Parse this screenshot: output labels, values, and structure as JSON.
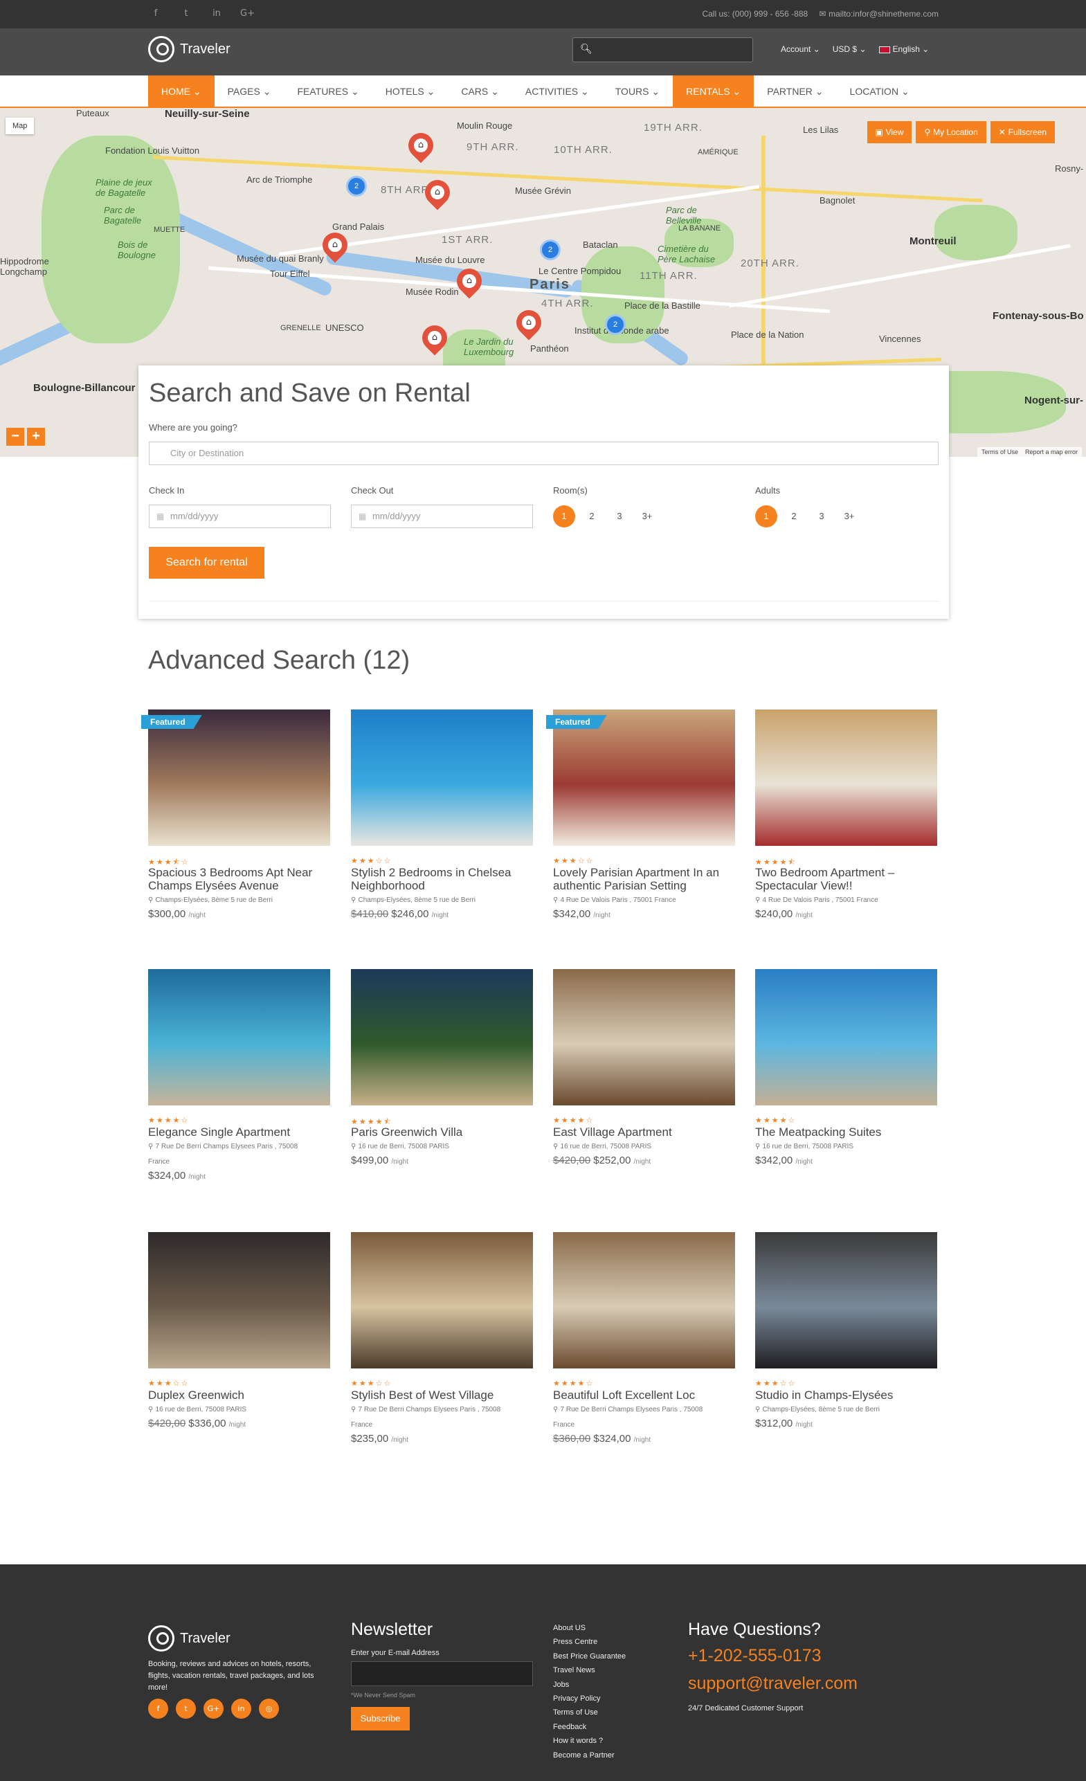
{
  "topbar": {
    "social": [
      "f",
      "t",
      "in",
      "G+"
    ],
    "phone": "Call us: (000) 999 - 656 -888",
    "email": "mailto:infor@shinetheme.com"
  },
  "header": {
    "logo": "Traveler",
    "search_icon": "search-icon",
    "account": "Account",
    "currency": "USD $",
    "language": "English"
  },
  "nav": [
    "HOME",
    "PAGES",
    "FEATURES",
    "HOTELS",
    "CARS",
    "ACTIVITIES",
    "TOURS",
    "RENTALS",
    "PARTNER",
    "LOCATION"
  ],
  "map": {
    "type_button": "Map",
    "view": "View",
    "my_location": "My Location",
    "fullscreen": "Fullscreen",
    "terms": "Terms of Use",
    "report": "Report a map error",
    "labels": {
      "neuilly": "Neuilly-sur-Seine",
      "puteaux": "Puteaux",
      "fondation": "Fondation Louis Vuitton",
      "plaine": "Plaine de jeux de Bagatelle",
      "parc": "Parc de Bagatelle",
      "bois": "Bois de Boulogne",
      "hippodrome": "Hippodrome Longchamp",
      "muette": "MUETTE",
      "arc": "Arc de Triomphe",
      "grandpalais": "Grand Palais",
      "eiffel": "Tour Eiffel",
      "branly": "Musée du quai Branly",
      "grenelle": "GRENELLE",
      "unesco": "UNESCO",
      "moulin": "Moulin Rouge",
      "ninth": "9TH ARR.",
      "eighth": "8TH ARR.",
      "first": "1ST ARR.",
      "grevin": "Musée Grévin",
      "louvre": "Musée du Louvre",
      "rodin": "Musée Rodin",
      "paris": "Paris",
      "fourth": "4TH ARR.",
      "luxembourg": "Le Jardin du Luxembourg",
      "pantheon": "Panthéon",
      "institut": "Institut du Monde arabe",
      "bastille": "Place de la Bastille",
      "pompidou": "Le Centre Pompidou",
      "bataclan": "Bataclan",
      "eleventh": "11TH ARR.",
      "tenth": "10TH ARR.",
      "nineteenth": "19TH ARR.",
      "amerique": "AMÉRIQUE",
      "belleville": "Parc de Belleville",
      "labanane": "LA BANANE",
      "cimetiere": "Cimetière du Père Lachaise",
      "twentieth": "20TH ARR.",
      "bagnolet": "Bagnolet",
      "montreuil": "Montreuil",
      "nation": "Place de la Nation",
      "vincennes": "Vincennes",
      "fontenay": "Fontenay-sous-Bo",
      "nogent": "Nogent-sur-",
      "boulogne": "Boulogne-Billancour",
      "leslilas": "Les Lilas",
      "rosny": "Rosny-"
    },
    "clusters": [
      "2",
      "2",
      "2"
    ]
  },
  "search": {
    "title": "Search and Save on Rental",
    "where_label": "Where are you going?",
    "where_placeholder": "City or Destination",
    "checkin_label": "Check In",
    "checkout_label": "Check Out",
    "date_placeholder": "mm/dd/yyyy",
    "rooms_label": "Room(s)",
    "adults_label": "Adults",
    "rooms": [
      "1",
      "2",
      "3",
      "3+"
    ],
    "adults": [
      "1",
      "2",
      "3",
      "3+"
    ],
    "submit": "Search for rental"
  },
  "results": {
    "title": "Advanced Search (12)",
    "featured_label": "Featured",
    "per_night": "/night",
    "items": [
      {
        "title": "Spacious 3 Bedrooms Apt Near Champs Elysées Avenue",
        "address": "Champs-Elysées, 8ème 5 rue de Berri",
        "old_price": "",
        "price": "$300,00",
        "stars": 3.5,
        "featured": true
      },
      {
        "title": "Stylish 2 Bedrooms in Chelsea Neighborhood",
        "address": "Champs-Elysées, 8ème 5 rue de Berri",
        "old_price": "$410,00",
        "price": "$246,00",
        "stars": 3,
        "featured": false
      },
      {
        "title": "Lovely Parisian Apartment In an authentic Parisian Setting",
        "address": "4 Rue De Valois Paris , 75001 France",
        "old_price": "",
        "price": "$342,00",
        "stars": 3,
        "featured": true
      },
      {
        "title": "Two Bedroom Apartment – Spectacular View!!",
        "address": "4 Rue De Valois Paris , 75001 France",
        "old_price": "",
        "price": "$240,00",
        "stars": 4.5,
        "featured": false
      },
      {
        "title": "Elegance Single Apartment",
        "address": "7 Rue De Berri Champs Elysees Paris , 75008 France",
        "old_price": "",
        "price": "$324,00",
        "stars": 4,
        "featured": false
      },
      {
        "title": "Paris Greenwich Villa",
        "address": "16 rue de Berri, 75008 PARIS",
        "old_price": "",
        "price": "$499,00",
        "stars": 4.5,
        "featured": false
      },
      {
        "title": "East Village Apartment",
        "address": "16 rue de Berri, 75008 PARIS",
        "old_price": "$420,00",
        "price": "$252,00",
        "stars": 4,
        "featured": false
      },
      {
        "title": "The Meatpacking Suites",
        "address": "16 rue de Berri, 75008 PARIS",
        "old_price": "",
        "price": "$342,00",
        "stars": 4,
        "featured": false
      },
      {
        "title": "Duplex Greenwich",
        "address": "16 rue de Berri, 75008 PARIS",
        "old_price": "$420,00",
        "price": "$336,00",
        "stars": 3,
        "featured": false
      },
      {
        "title": "Stylish Best of West Village",
        "address": "7 Rue De Berri Champs Elysees Paris , 75008 France",
        "old_price": "",
        "price": "$235,00",
        "stars": 3,
        "featured": false
      },
      {
        "title": "Beautiful Loft Excellent Loc",
        "address": "7 Rue De Berri Champs Elysees Paris , 75008 France",
        "old_price": "$360,00",
        "price": "$324,00",
        "stars": 4,
        "featured": false
      },
      {
        "title": "Studio in Champs-Elysées",
        "address": "Champs-Elysées, 8ème 5 rue de Berri",
        "old_price": "",
        "price": "$312,00",
        "stars": 3,
        "featured": false
      }
    ]
  },
  "footer": {
    "logo": "Traveler",
    "description": "Booking, reviews and advices on hotels, resorts, flights, vacation rentals, travel packages, and lots more!",
    "socials": [
      "f",
      "t",
      "G+",
      "in",
      "◎"
    ],
    "newsletter_title": "Newsletter",
    "newsletter_label": "Enter your E-mail Address",
    "newsletter_note": "*We Never Send Spam",
    "subscribe": "Subscribe",
    "links": [
      "About US",
      "Press Centre",
      "Best Price Guarantee",
      "Travel News",
      "Jobs",
      "Privacy Policy",
      "Terms of Use",
      "Feedback",
      "How it words ?",
      "Become a Partner"
    ],
    "questions_title": "Have Questions?",
    "phone": "+1-202-555-0173",
    "email": "support@traveler.com",
    "support": "24/7 Dedicated Customer Support"
  }
}
